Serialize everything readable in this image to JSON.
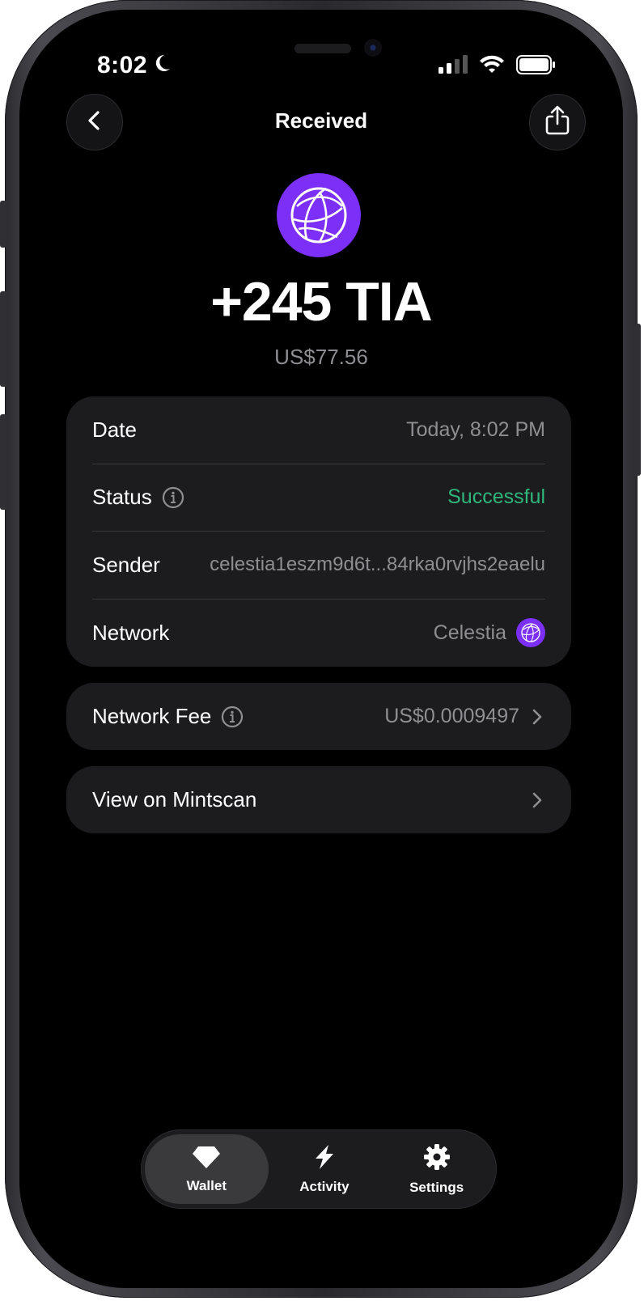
{
  "status_bar": {
    "time": "8:02"
  },
  "header": {
    "title": "Received"
  },
  "hero": {
    "amount": "+245 TIA",
    "fiat_value": "US$77.56"
  },
  "details": {
    "date": {
      "label": "Date",
      "value": "Today, 8:02 PM"
    },
    "status": {
      "label": "Status",
      "value": "Successful"
    },
    "sender": {
      "label": "Sender",
      "value": "celestia1eszm9d6t...84rka0rvjhs2eaelu"
    },
    "network": {
      "label": "Network",
      "value": "Celestia"
    }
  },
  "network_fee": {
    "label": "Network Fee",
    "value": "US$0.0009497"
  },
  "explorer_link": {
    "label": "View on Mintscan"
  },
  "tabbar": {
    "tabs": [
      {
        "label": "Wallet",
        "icon": "diamond-icon",
        "active": true
      },
      {
        "label": "Activity",
        "icon": "lightning-icon",
        "active": false
      },
      {
        "label": "Settings",
        "icon": "gear-icon",
        "active": false
      }
    ]
  },
  "colors": {
    "accent_purple": "#7b2ff7",
    "success_green": "#2fb67c",
    "card_bg": "#1c1c1e",
    "muted_text": "#8e8e93"
  }
}
